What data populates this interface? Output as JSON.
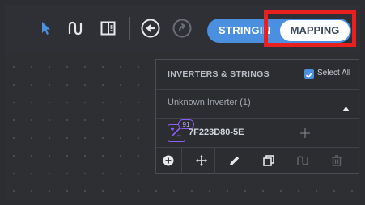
{
  "toolbar": {
    "icons": [
      "cursor-icon",
      "string-path-icon",
      "panel-layout-icon",
      "undo-icon",
      "redo-icon"
    ]
  },
  "mode_toggle": {
    "options": [
      "STRINGING",
      "MAPPING"
    ],
    "visible_left_label": "STRINGIN",
    "right_label": "MAPPING",
    "selected": "MAPPING",
    "accent_color": "#4a8fe0"
  },
  "panel": {
    "title": "INVERTERS & STRINGS",
    "select_all_label": "Select All",
    "select_all_checked": true,
    "group_label": "Unknown Inverter (1)",
    "string": {
      "badge_count": "91",
      "id": "7F223D80-5E"
    },
    "actions": [
      "add-icon",
      "move-icon",
      "edit-icon",
      "copy-icon",
      "stringing-icon",
      "delete-icon"
    ]
  },
  "colors": {
    "highlight_border": "#e82020",
    "badge_purple": "#8b5cf6"
  }
}
